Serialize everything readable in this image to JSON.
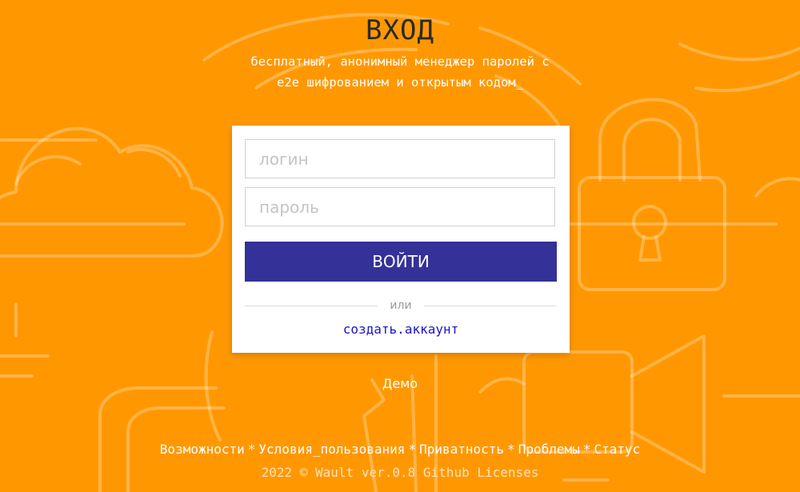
{
  "header": {
    "title": "ВХОД",
    "tagline": "бесплатный, анонимный менеджер паролей с e2e шифрованием и открытым кодом_"
  },
  "form": {
    "login_placeholder": "логин",
    "password_placeholder": "пароль",
    "submit_label": "ВОЙТИ",
    "divider_text": "или",
    "create_account_label": "создать.аккаунт"
  },
  "demo_label": "Демо",
  "footer": {
    "nav": [
      "Возможности",
      "Условия_пользования",
      "Приватность",
      "Проблемы",
      "Статус"
    ],
    "separator": "*",
    "year_copyright": "2022 ©",
    "brand": "Wault",
    "version": "ver.0.8",
    "github_label": "Github",
    "licenses_label": "Licenses"
  },
  "colors": {
    "background": "#ff9800",
    "button": "#343198",
    "link": "#1a14c8"
  },
  "icons": [
    "cloud-icon",
    "padlock-icon",
    "video-camera-icon",
    "chat-bubble-icon"
  ]
}
